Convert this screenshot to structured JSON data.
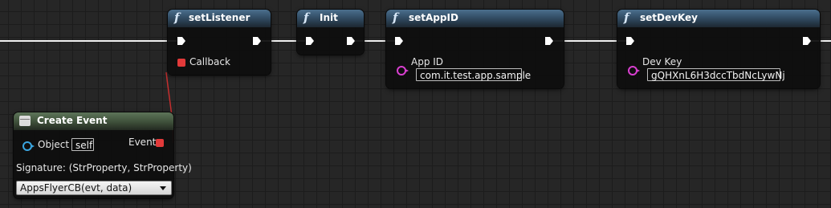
{
  "nodes": {
    "set_listener": {
      "title": "setListener",
      "pin_callback": "Callback"
    },
    "init": {
      "title": "Init"
    },
    "set_app_id": {
      "title": "setAppID",
      "pin_label": "App ID",
      "pin_value": "com.it.test.app.sample"
    },
    "set_dev_key": {
      "title": "setDevKey",
      "pin_label": "Dev Key",
      "pin_value": "gQHXnL6H3dccTbdNcLywNj"
    },
    "create_event": {
      "title": "Create Event",
      "pin_object": "Object",
      "pin_object_value": "self",
      "pin_event": "Event",
      "signature": "Signature: (StrProperty, StrProperty)",
      "selected_function": "AppsFlyerCB(evt, data)"
    }
  },
  "icons": {
    "function": "function-icon",
    "event": "event-icon",
    "exec_pin": "exec-pin-icon",
    "delegate_pin": "delegate-pin-icon",
    "string_pin": "string-pin-icon",
    "object_pin": "object-pin-icon"
  },
  "colors": {
    "function_header": "#35516a",
    "event_header": "#44573f",
    "exec_wire": "#ffffff",
    "delegate_wire": "#e23a3a",
    "string_pin": "#d93fd0",
    "object_pin": "#3aa5e0",
    "canvas": "#262626"
  }
}
